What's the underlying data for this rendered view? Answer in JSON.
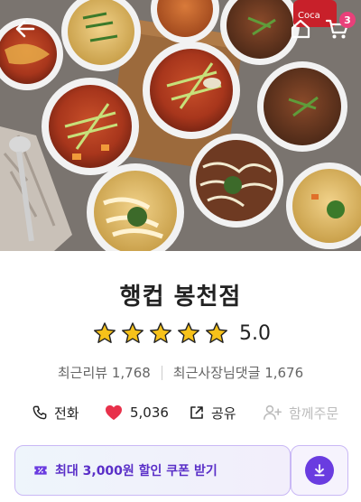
{
  "store": {
    "name": "행컵 봉천점",
    "rating": "5.0",
    "stars": 5
  },
  "header": {
    "cart_count": "3",
    "icons": [
      "back-arrow-icon",
      "home-icon",
      "cart-icon"
    ]
  },
  "stats": {
    "recent_reviews_label": "최근리뷰",
    "recent_reviews_count": "1,768",
    "owner_comments_label": "최근사장님댓글",
    "owner_comments_count": "1,676"
  },
  "actions": {
    "call_label": "전화",
    "likes_count": "5,036",
    "share_label": "공유",
    "group_order_label": "함께주문"
  },
  "coupon": {
    "label": "최대 3,000원 할인 쿠폰 받기"
  },
  "colors": {
    "accent": "#6a3ce0",
    "badge": "#e9407a",
    "star": "#f7c21a",
    "heart": "#e8314b"
  }
}
